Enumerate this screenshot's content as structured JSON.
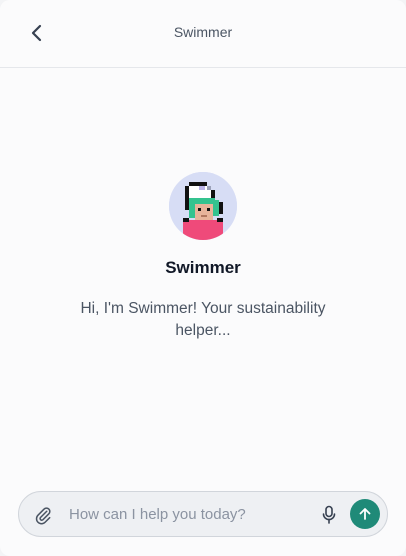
{
  "header": {
    "title": "Swimmer",
    "back_icon": "chevron-left-icon"
  },
  "agent": {
    "name": "Swimmer",
    "greeting": "Hi, I'm Swimmer! Your sustainability helper...",
    "avatar": "pixel-art-swimmer-avatar"
  },
  "composer": {
    "placeholder": "How can I help you today?",
    "value": "",
    "attach_icon": "paperclip-icon",
    "mic_icon": "microphone-icon",
    "send_icon": "arrow-up-icon"
  },
  "colors": {
    "background": "#fbfbfc",
    "accent": "#1f8a78",
    "avatar_bg": "#d7ddf5",
    "hair_green": "#34c38f",
    "shirt_pink": "#ef4a7a"
  }
}
